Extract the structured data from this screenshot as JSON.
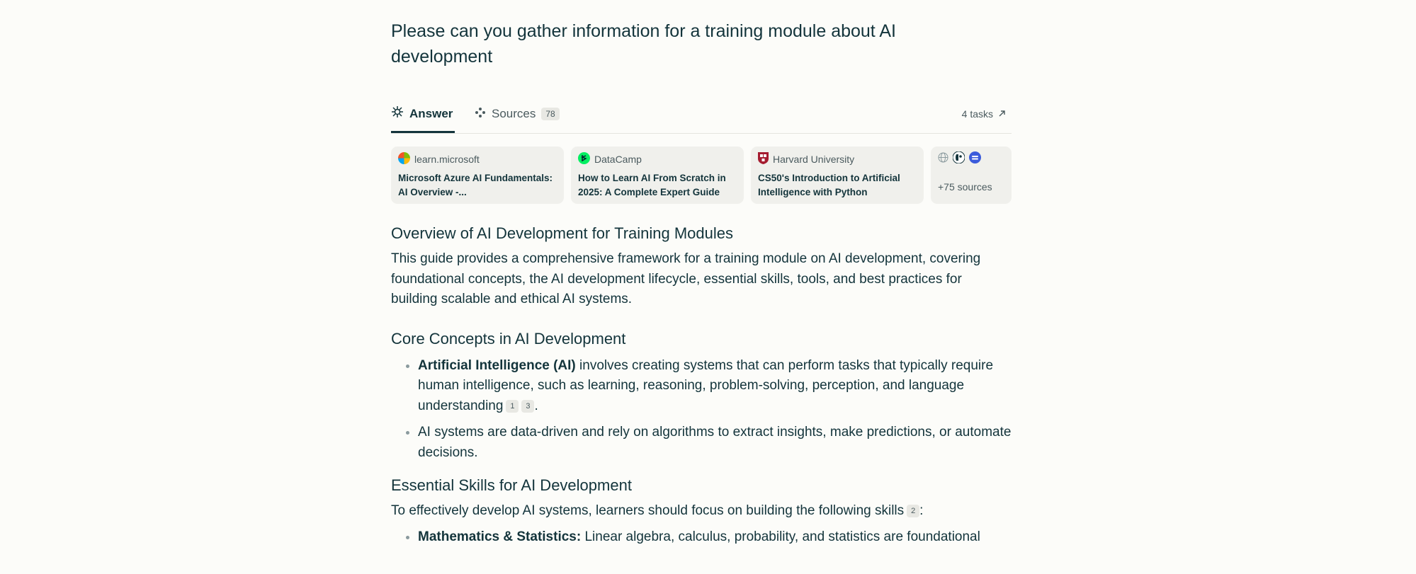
{
  "query": "Please can you gather information for a training module about AI development",
  "tabs": {
    "answer_label": "Answer",
    "sources_label": "Sources",
    "sources_count": "78",
    "tasks_label": "4 tasks"
  },
  "source_cards": [
    {
      "site": "learn.microsoft",
      "title": "Microsoft Azure AI Fundamentals: AI Overview -..."
    },
    {
      "site": "DataCamp",
      "title": "How to Learn AI From Scratch in 2025: A Complete Expert Guide"
    },
    {
      "site": "Harvard University",
      "title": "CS50's Introduction to Artificial Intelligence with Python"
    }
  ],
  "more_sources_label": "+75 sources",
  "sections": {
    "overview": {
      "heading": "Overview of AI Development for Training Modules",
      "text": "This guide provides a comprehensive framework for a training module on AI development, covering foundational concepts, the AI development lifecycle, essential skills, tools, and best practices for building scalable and ethical AI systems."
    },
    "core": {
      "heading": "Core Concepts in AI Development",
      "bullet1_bold": "Artificial Intelligence (AI)",
      "bullet1_text": " involves creating systems that can perform tasks that typically require human intelligence, such as learning, reasoning, problem-solving, perception, and language understanding",
      "bullet1_cites": [
        "1",
        "3"
      ],
      "bullet2_text": "AI systems are data-driven and rely on algorithms to extract insights, make predictions, or automate decisions."
    },
    "skills": {
      "heading": "Essential Skills for AI Development",
      "intro": "To effectively develop AI systems, learners should focus on building the following skills",
      "intro_cite": "2",
      "bullet1_bold": "Mathematics & Statistics:",
      "bullet1_text": " Linear algebra, calculus, probability, and statistics are foundational"
    }
  },
  "colors": {
    "background": "#fcfcf9",
    "text": "#13343b",
    "muted": "#4a5a5e",
    "card": "#f0f0ec"
  }
}
